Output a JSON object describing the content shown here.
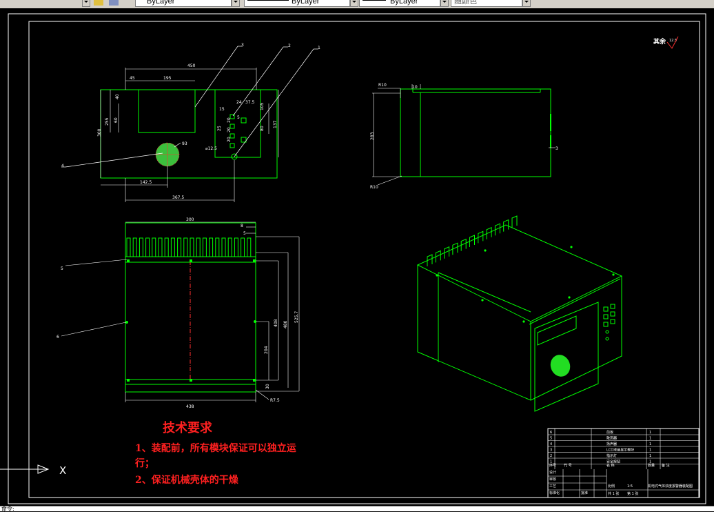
{
  "toolbar": {
    "layer_value": "ByLayer",
    "linetype_value": "ByLayer",
    "lineweight_value": "ByLayer",
    "color_value": "随颜色"
  },
  "drawing": {
    "labels": {
      "part_1": "1",
      "part_2": "2",
      "part_3": "3",
      "part_4": "4",
      "part_5": "5",
      "part_6": "6"
    },
    "dims_top": {
      "d450": "450",
      "d45": "45",
      "d195": "195",
      "d40": "40",
      "d60": "60",
      "d255": "255",
      "d300": "300",
      "d15": "15",
      "d24": "24",
      "d37_5": "37.5",
      "d105": "105",
      "d137": "137",
      "d80": "80",
      "d93": "93",
      "d12_5": "⌀12.5",
      "d142_5": "142.5",
      "d367_5": "367.5",
      "d20a": "20",
      "d20b": "20",
      "d20c": "20",
      "d25": "25",
      "d5": "5"
    },
    "dims_side": {
      "r10_top": "R10",
      "d10": "10",
      "d283": "283",
      "r10_bot": "R10",
      "d3": "3"
    },
    "dims_front": {
      "d300": "300",
      "d8": "8",
      "d5": "5",
      "d525_7": "525.7",
      "d480": "480",
      "d408": "408",
      "d204": "204",
      "d30": "30",
      "d438": "438",
      "r7_5": "R7.5"
    },
    "roughness": "其余",
    "roughness_value": "12.5",
    "tech_title": "技术要求",
    "tech_1a": "1、装配前，所有模块保证可以独立运",
    "tech_1b": "行；",
    "tech_2": "2、保证机械壳体的干燥",
    "ucs_label": "X"
  },
  "title_block": {
    "rows": [
      {
        "no": "6",
        "name": "前板",
        "qty": "1"
      },
      {
        "no": "5",
        "name": "散热器",
        "qty": "1"
      },
      {
        "no": "4",
        "name": "扬声器",
        "qty": "1"
      },
      {
        "no": "3",
        "name": "LCD液晶显示模块",
        "qty": "1"
      },
      {
        "no": "2",
        "name": "指示灯",
        "qty": "1"
      },
      {
        "no": "1",
        "name": "安全按钮",
        "qty": "1"
      }
    ],
    "header": {
      "no": "序号",
      "code": "代 号",
      "name": "名 称",
      "qty": "数量",
      "note": "备 注"
    },
    "design": "设计",
    "check": "审核",
    "process": "工艺",
    "standard": "标准化",
    "approve": "批准",
    "scale": "1:5",
    "title": "机电式气体浓度报警器装配图",
    "sheets": "共 1 张",
    "sheet": "第 1 张",
    "ratio_label": "比例"
  },
  "command": {
    "prompt": "命令: "
  }
}
